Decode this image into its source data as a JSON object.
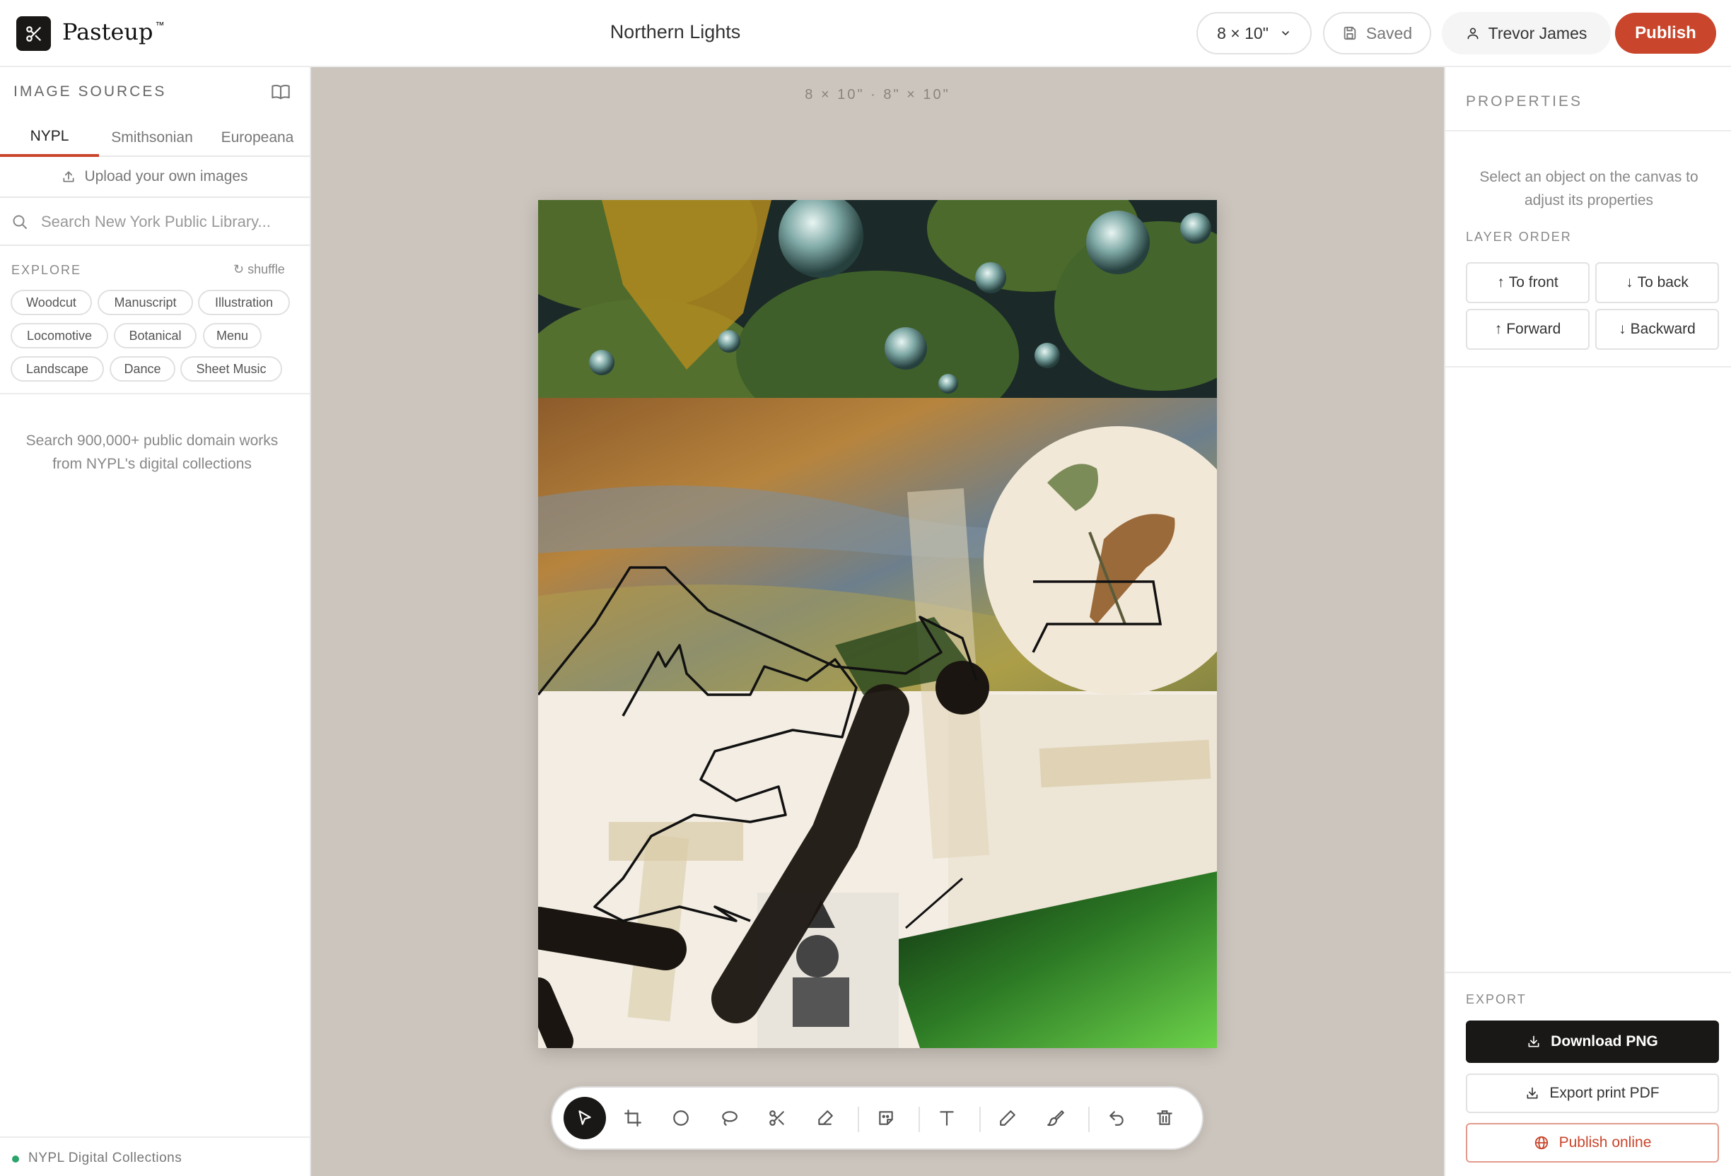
{
  "app": {
    "brand": "Pasteup",
    "trademark": "™",
    "document_title": "Northern Lights",
    "size_select": "8 × 10\"",
    "save_status": "Saved",
    "user_name": "Trevor James",
    "publish_label": "Publish"
  },
  "sidebar": {
    "title": "IMAGE SOURCES",
    "tabs": [
      {
        "label": "NYPL",
        "active": true
      },
      {
        "label": "Smithsonian",
        "active": false
      },
      {
        "label": "Europeana",
        "active": false
      }
    ],
    "upload_label": "Upload your own images",
    "search_placeholder": "Search New York Public Library...",
    "explore_label": "EXPLORE",
    "shuffle_label": "shuffle",
    "chips": [
      "Woodcut",
      "Manuscript",
      "Illustration",
      "Locomotive",
      "Botanical",
      "Menu",
      "Landscape",
      "Dance",
      "Sheet Music"
    ],
    "hint_line1": "Search 900,000+ public domain works",
    "hint_line2": "from NYPL's digital collections",
    "footer_status": "NYPL Digital Collections",
    "footer_status_color": "#2ba36b"
  },
  "canvas": {
    "dimensions_label": "8 × 10\" · 8\" × 10\""
  },
  "toolbar": {
    "tools": [
      "select-tool",
      "crop-tool",
      "ellipse-tool",
      "lasso-tool",
      "scissors-tool",
      "eraser-tool",
      "sticker-tool",
      "text-tool",
      "pencil-tool",
      "brush-tool",
      "undo-tool",
      "delete-tool"
    ],
    "active_tool": "select-tool"
  },
  "properties": {
    "title": "PROPERTIES",
    "hint_line1": "Select an object on the canvas to",
    "hint_line2": "adjust its properties",
    "layer_order_title": "LAYER ORDER",
    "to_front": "To front",
    "to_back": "To back",
    "forward": "Forward",
    "backward": "Backward",
    "export_title": "EXPORT",
    "download_png": "Download PNG",
    "export_pdf": "Export print PDF",
    "publish_online": "Publish online"
  },
  "colors": {
    "accent": "#c9452b",
    "dark": "#1a1816",
    "canvas_bg": "#ccc5bd"
  }
}
